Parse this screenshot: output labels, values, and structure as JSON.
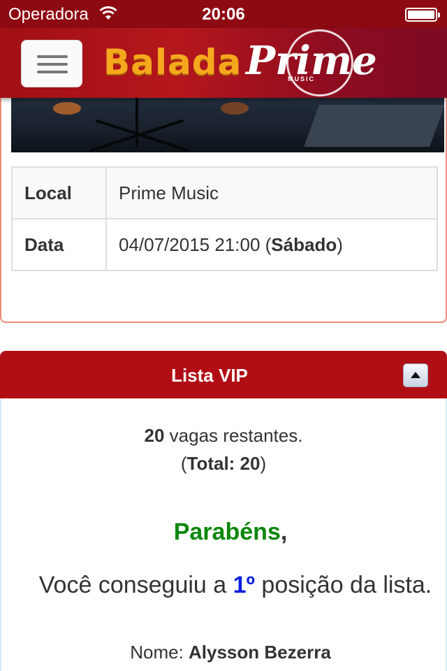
{
  "status_bar": {
    "carrier": "Operadora",
    "time": "20:06"
  },
  "navbar": {
    "logo_left": "Balada",
    "logo_right": "Prime",
    "logo_small": "MUSIC",
    "colors": {
      "brand_red": "#b10d14",
      "logo_gold": "#f6a81d"
    }
  },
  "event": {
    "rows": [
      {
        "label": "Local",
        "value": "Prime Music"
      },
      {
        "label": "Data",
        "value": "04/07/2015 21:00 (",
        "value_bold": "Sábado",
        "value_after": ")"
      }
    ]
  },
  "vip": {
    "title": "Lista VIP",
    "collapse_icon": "triangle-up-icon",
    "remaining_count": "20",
    "remaining_text": " vagas restantes.",
    "total_open": "(",
    "total_label": "Total: 20",
    "total_close": ")",
    "congrats_word": "Parabéns",
    "congrats_comma": ",",
    "position_before": "Você conseguiu a ",
    "position_value": "1º",
    "position_after": " posição da lista.",
    "name_label": "Nome: ",
    "name_value": "Alysson Bezerra",
    "colors": {
      "congrats": "#0b870b",
      "position": "#0a1ee0"
    }
  }
}
